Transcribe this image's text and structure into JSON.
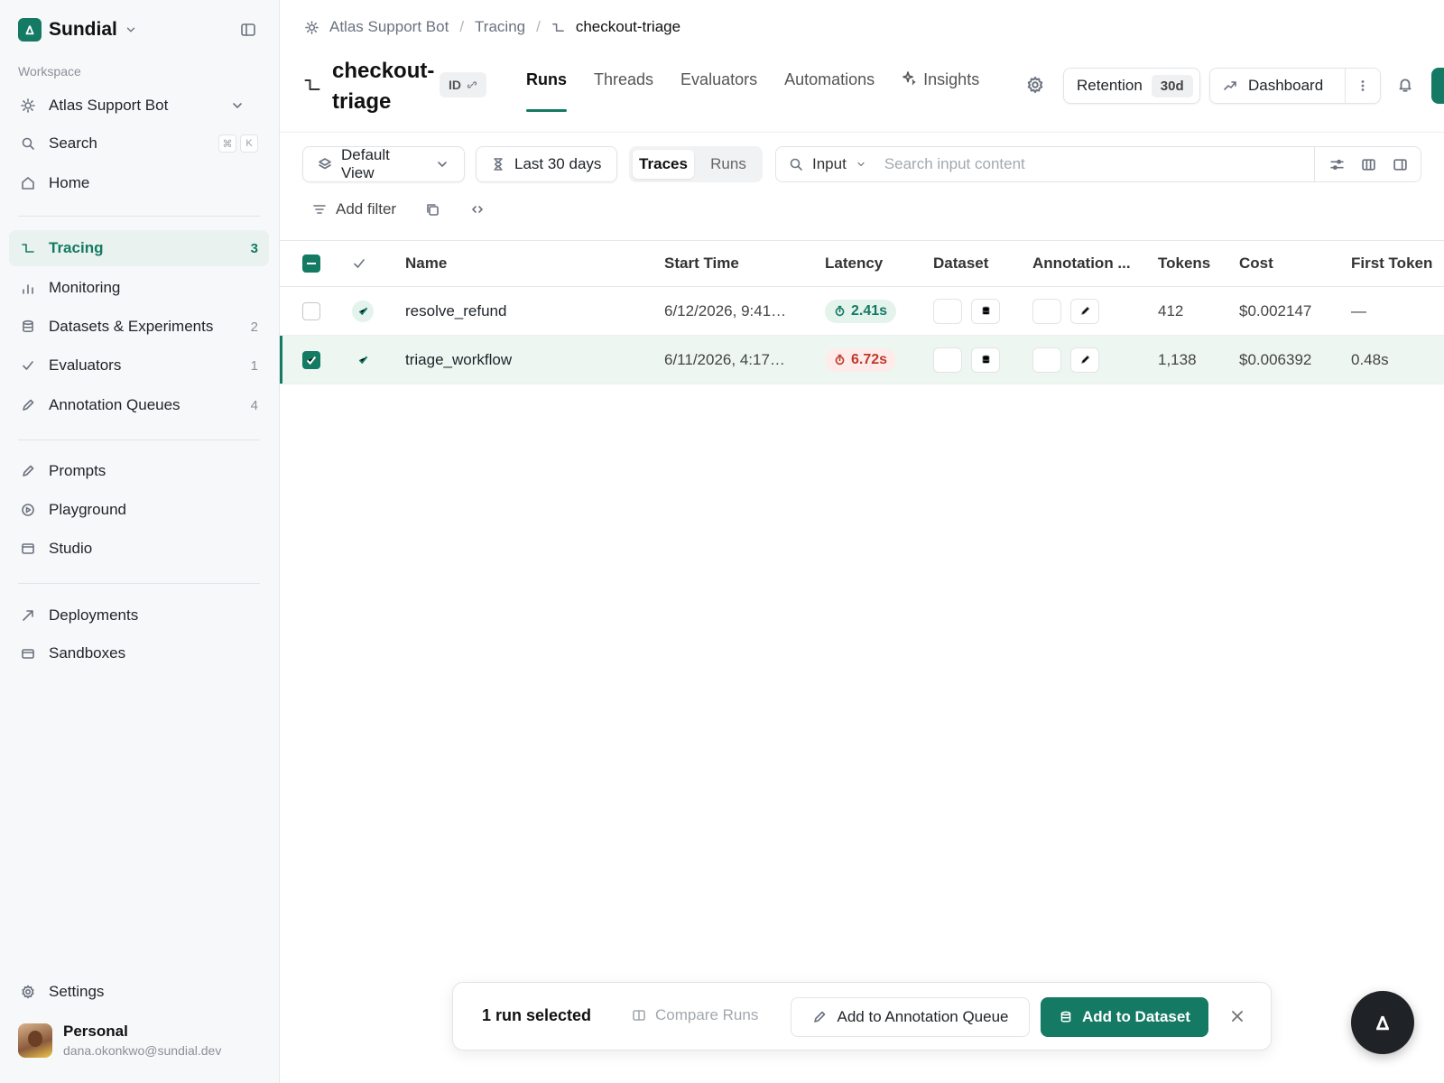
{
  "sidebar": {
    "brand": "Sundial",
    "workspace_label": "Workspace",
    "workspace": "Atlas Support Bot",
    "search_label": "Search",
    "search_shortcut": [
      "⌘",
      "K"
    ],
    "home_label": "Home",
    "items": [
      {
        "label": "Tracing",
        "count": "3",
        "icon": "tracing-icon"
      },
      {
        "label": "Monitoring",
        "count": "",
        "icon": "bar-chart-icon"
      },
      {
        "label": "Datasets & Experiments",
        "count": "2",
        "icon": "database-icon"
      },
      {
        "label": "Evaluators",
        "count": "1",
        "icon": "check-icon"
      },
      {
        "label": "Annotation Queues",
        "count": "4",
        "icon": "pencil-icon"
      }
    ],
    "tools": [
      {
        "label": "Prompts",
        "icon": "prompt-icon"
      },
      {
        "label": "Playground",
        "icon": "play-icon"
      },
      {
        "label": "Studio",
        "icon": "studio-icon"
      }
    ],
    "deploy": [
      {
        "label": "Deployments",
        "icon": "rocket-icon"
      },
      {
        "label": "Sandboxes",
        "icon": "sandbox-icon"
      }
    ],
    "settings_label": "Settings",
    "profile": {
      "name": "Personal",
      "email": "dana.okonkwo@sundial.dev"
    }
  },
  "header": {
    "breadcrumb": [
      "Atlas Support Bot",
      "Tracing",
      "checkout-triage"
    ],
    "title_line1": "checkout-",
    "title_line2": "triage",
    "id_label": "ID",
    "tabs": [
      "Runs",
      "Threads",
      "Evaluators",
      "Automations",
      "Insights"
    ],
    "active_tab": "Runs",
    "retention_label": "Retention",
    "retention_value": "30d",
    "dashboard_label": "Dashboard"
  },
  "toolbar": {
    "view_label": "Default View",
    "range_label": "Last 30 days",
    "segment": [
      "Traces",
      "Runs"
    ],
    "segment_active": "Traces",
    "search_field": "Input",
    "search_placeholder": "Search input content",
    "add_filter_label": "Add filter"
  },
  "table": {
    "columns": [
      "Name",
      "Start Time",
      "Latency",
      "Dataset",
      "Annotation ...",
      "Tokens",
      "Cost",
      "First Token"
    ],
    "rows": [
      {
        "name": "resolve_refund",
        "start": "6/12/2026, 9:41…",
        "latency": "2.41s",
        "latency_status": "good",
        "tokens": "412",
        "cost": "$0.002147",
        "first_token": "—",
        "selected": false
      },
      {
        "name": "triage_workflow",
        "start": "6/11/2026, 4:17…",
        "latency": "6.72s",
        "latency_status": "bad",
        "tokens": "1,138",
        "cost": "$0.006392",
        "first_token": "0.48s",
        "selected": true
      }
    ]
  },
  "actionbar": {
    "selected_text": "1 run selected",
    "compare_label": "Compare Runs",
    "annotation_label": "Add to Annotation Queue",
    "dataset_label": "Add to Dataset"
  },
  "colors": {
    "accent": "#147a64",
    "danger": "#c0392b"
  }
}
